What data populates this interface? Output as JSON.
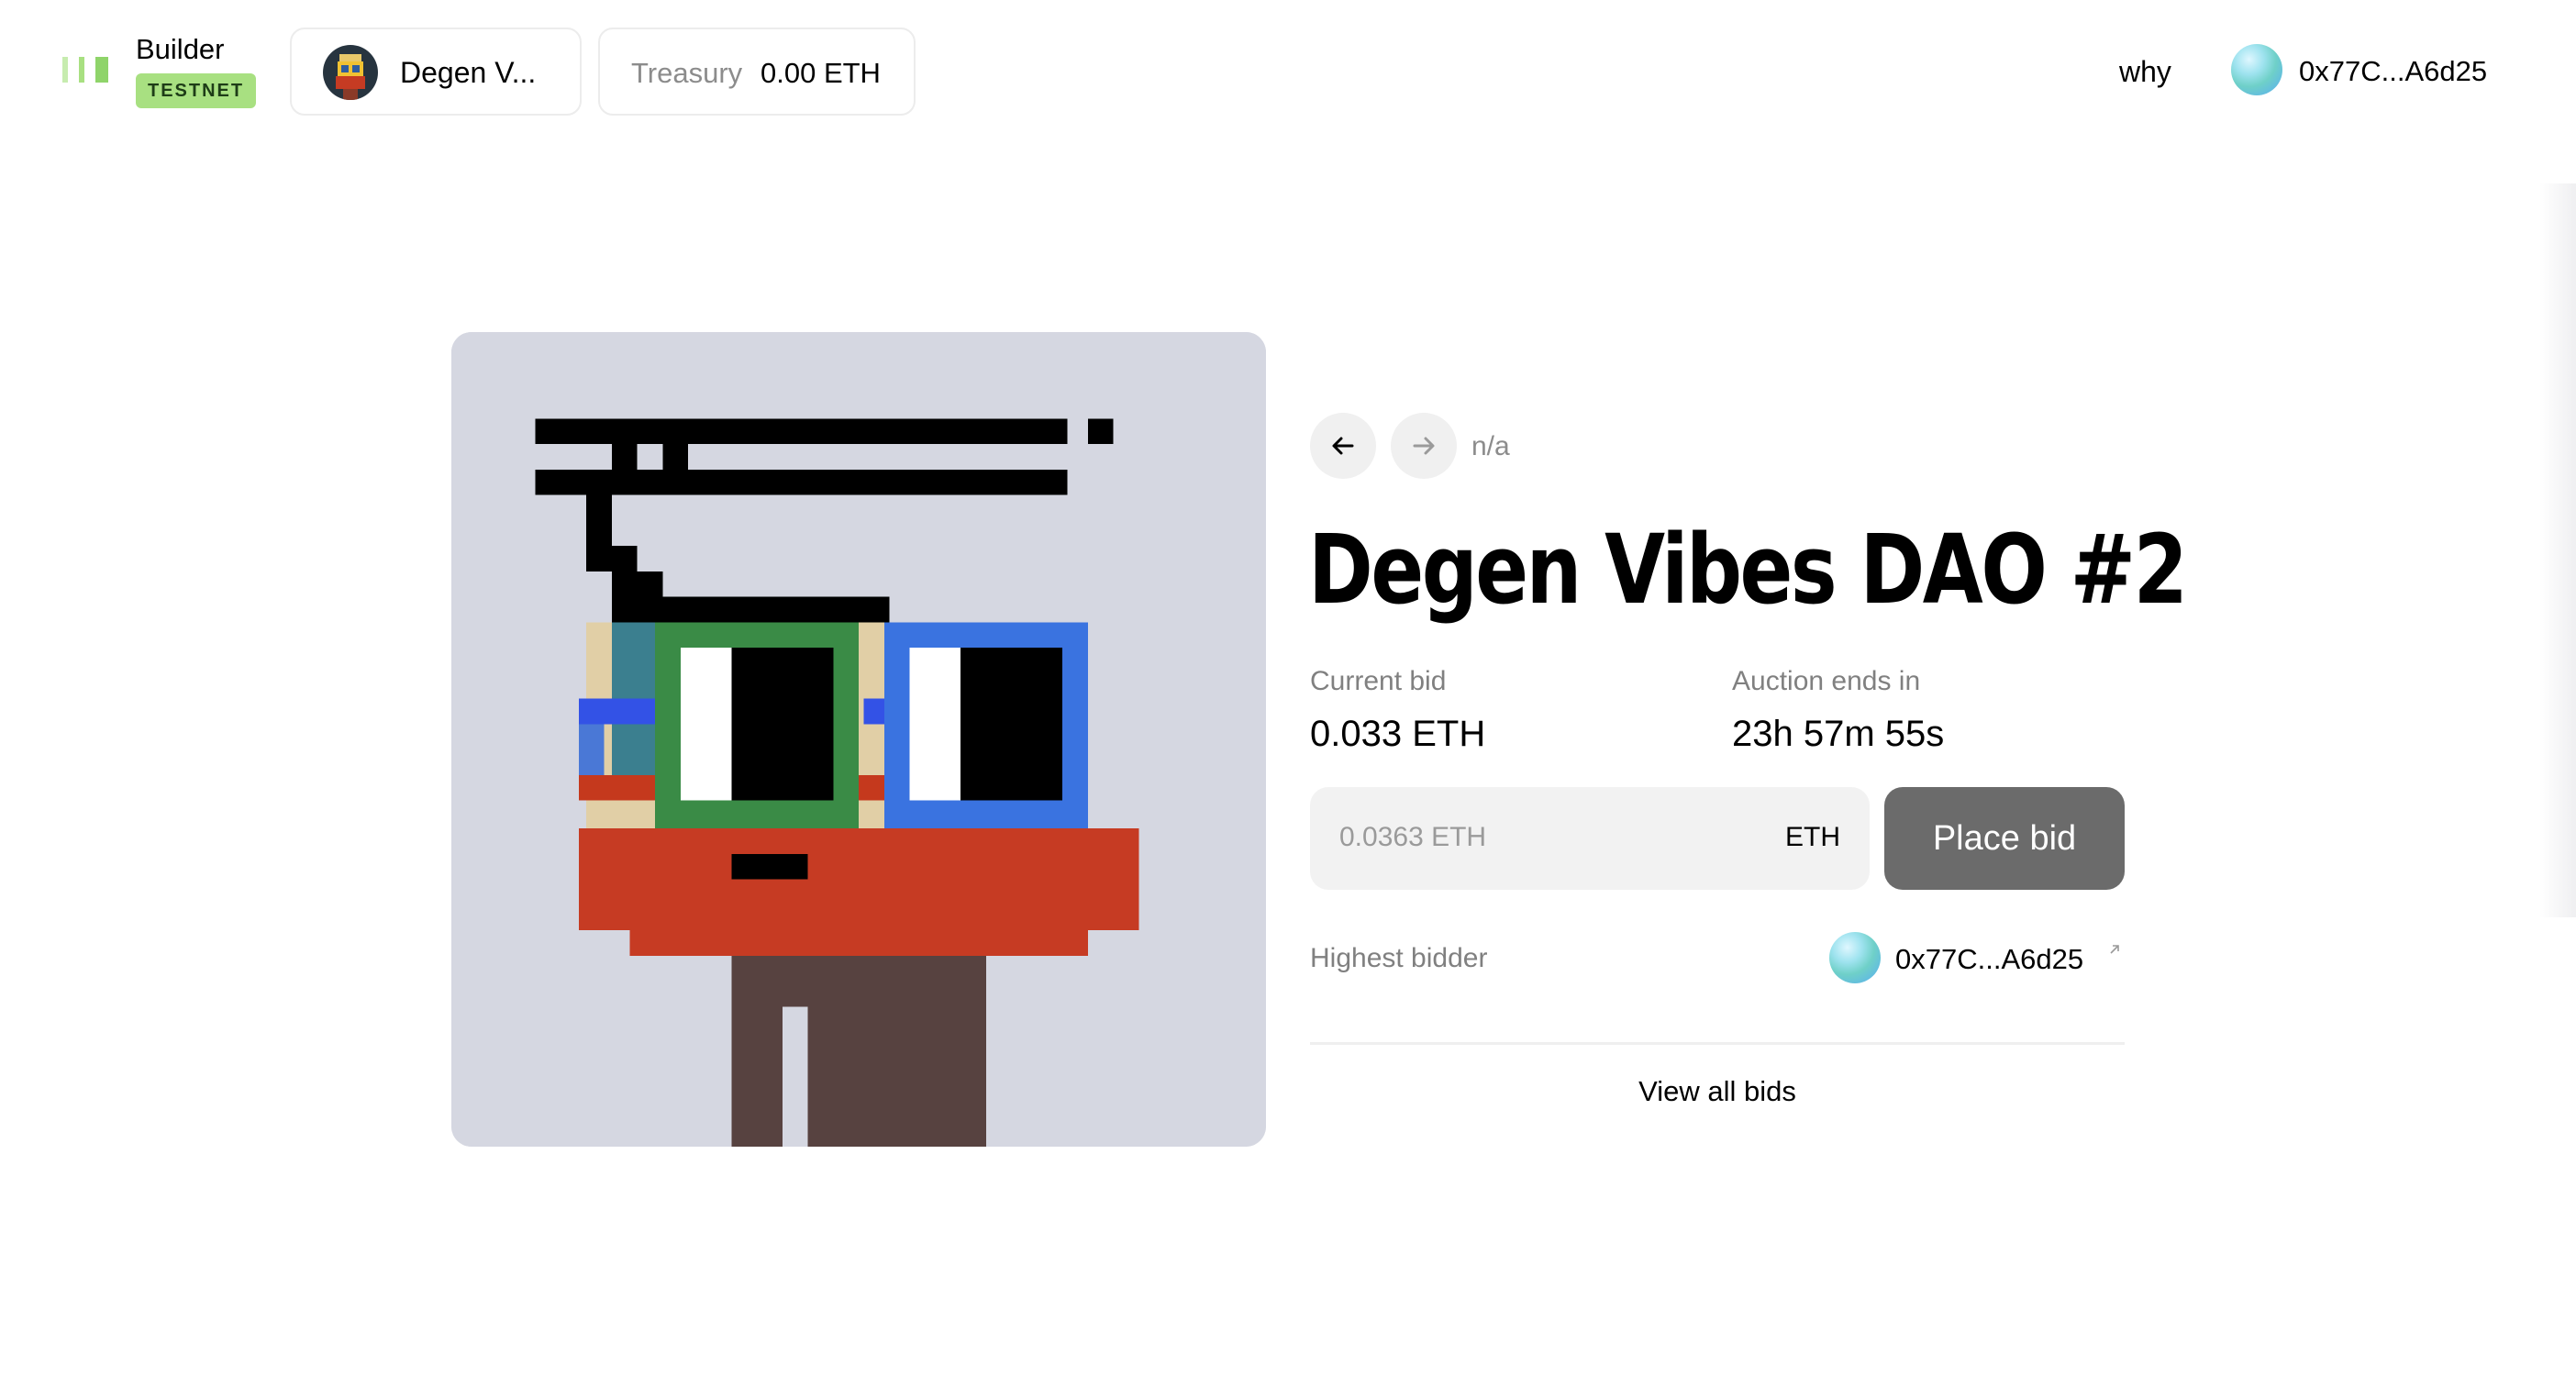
{
  "header": {
    "brand": "Builder",
    "network_badge": "TESTNET",
    "dao_name": "Degen V...",
    "treasury_label": "Treasury",
    "treasury_value": "0.00 ETH",
    "nav_link": "why",
    "wallet_address": "0x77C...A6d25"
  },
  "auction": {
    "date_text": "n/a",
    "title": "Degen Vibes DAO #2",
    "current_bid_label": "Current bid",
    "current_bid_value": "0.033 ETH",
    "ends_label": "Auction ends in",
    "ends_value": "23h 57m 55s",
    "bid_placeholder": "0.0363 ETH",
    "bid_unit": "ETH",
    "place_bid_label": "Place bid",
    "highest_bidder_label": "Highest bidder",
    "highest_bidder_address": "0x77C...A6d25",
    "view_all_bids_label": "View all bids"
  },
  "icons": {
    "logo": "builder-logo-icon",
    "prev": "arrow-left-icon",
    "next": "arrow-right-icon",
    "external": "external-link-icon",
    "wallet_avatar": "gradient-orb-avatar"
  },
  "colors": {
    "background": "#ffffff",
    "art_background": "#d5d7e1",
    "testnet_badge": "#a8e081",
    "logo_bar": "#8fd46a",
    "place_bid_button": "#6b6b6b",
    "input_background": "#f2f2f2",
    "muted_text": "#8c8c8c"
  }
}
